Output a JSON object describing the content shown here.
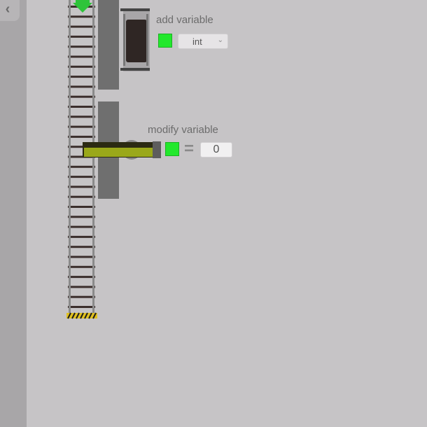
{
  "navigation": {
    "back_icon": "chevron-left-icon"
  },
  "blocks": {
    "add_variable": {
      "label": "add variable",
      "color": "#22e82c",
      "type_select": {
        "selected": "int",
        "icon": "chevron-down-icon"
      }
    },
    "modify_variable": {
      "label": "modify variable",
      "color": "#22e82c",
      "operator": "=",
      "value": "0"
    }
  },
  "colors": {
    "background": "#c6c4c6",
    "side_panel": "#a8a6a8",
    "track_rail": "#8a8a8a",
    "track_tie": "#3b2e2c",
    "station_wall": "#6f6f6f",
    "variable_green": "#22e82c",
    "lever_olive": "#9aa81a"
  }
}
